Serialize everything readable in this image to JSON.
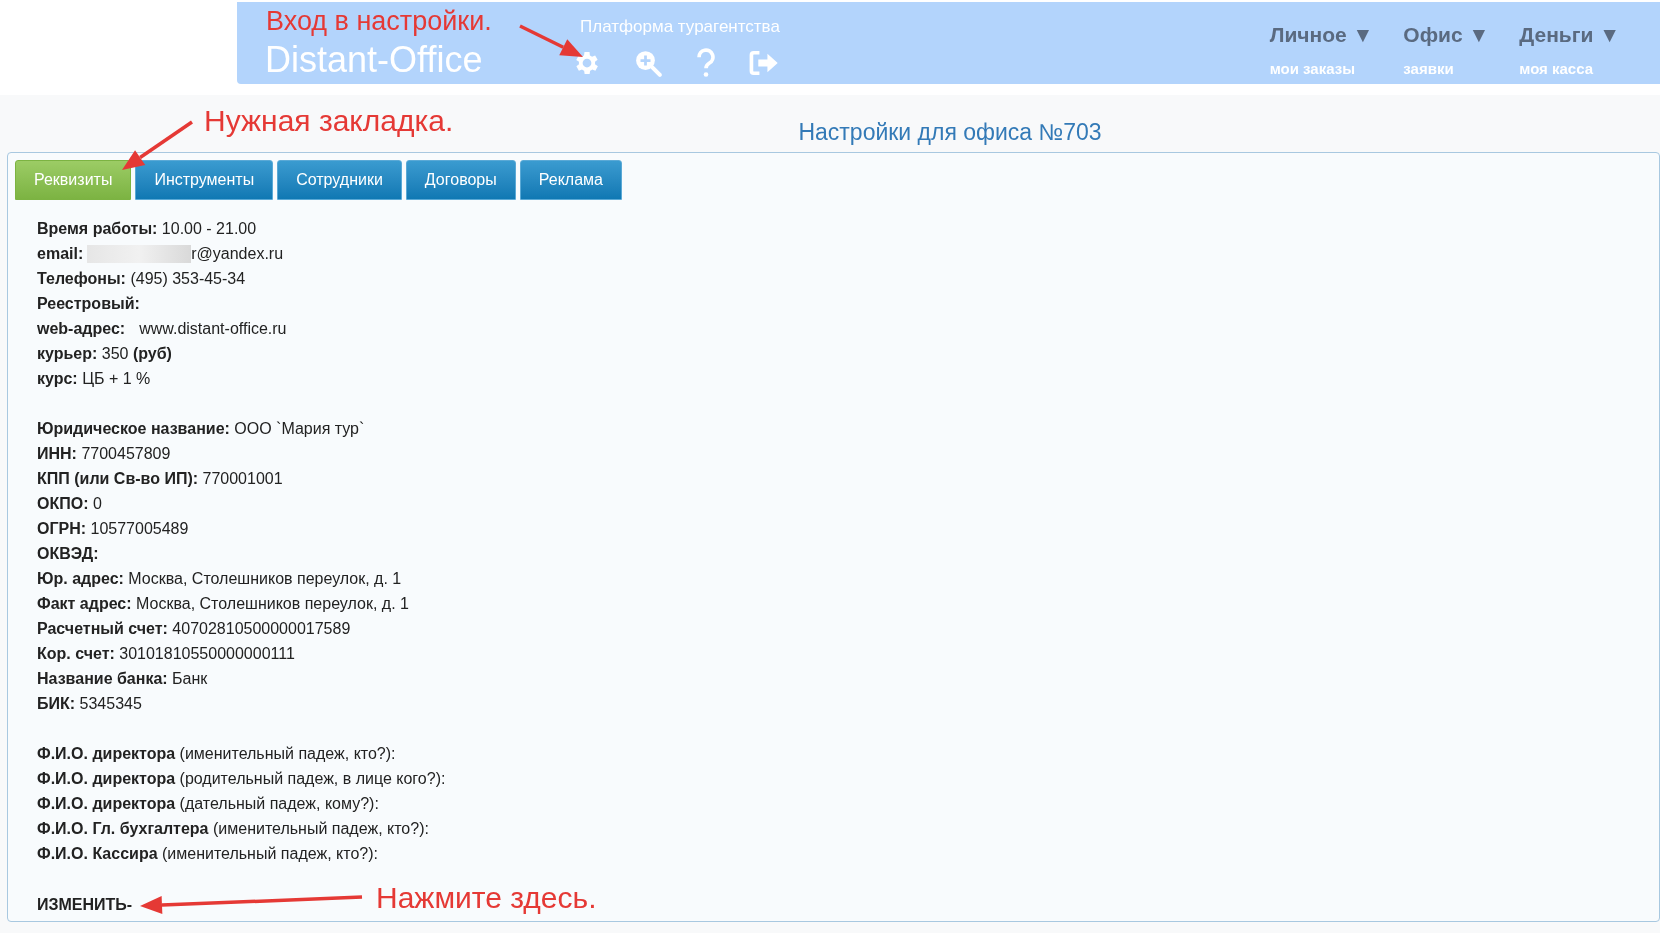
{
  "header": {
    "logo": "Distant-Office",
    "tagline": "Платформа турагентства",
    "menus": [
      {
        "label": "Личное ▼",
        "link": "мои заказы"
      },
      {
        "label": "Офис ▼",
        "link": "заявки"
      },
      {
        "label": "Деньги ▼",
        "link": "моя касса"
      }
    ]
  },
  "page_title": "Настройки для офиса №703",
  "tabs": [
    {
      "label": "Реквизиты",
      "selected": true
    },
    {
      "label": "Инструменты",
      "selected": false
    },
    {
      "label": "Сотрудники",
      "selected": false
    },
    {
      "label": "Договоры",
      "selected": false
    },
    {
      "label": "Реклама",
      "selected": false
    }
  ],
  "groups": [
    [
      {
        "kind": "plain",
        "label": "Время работы:",
        "value": "10.00 - 21.00"
      },
      {
        "kind": "redacted",
        "label": "email:",
        "value": "r@yandex.ru"
      },
      {
        "kind": "plain",
        "label": "Телефоны:",
        "value": "(495) 353-45-34"
      },
      {
        "kind": "plain",
        "label": "Реестровый:"
      },
      {
        "kind": "link",
        "label": "web-адрес:",
        "value": "www.distant-office.ru"
      },
      {
        "kind": "plain",
        "label": "курьер:",
        "value": "350 **(руб)**"
      },
      {
        "kind": "plain",
        "label": "курс:",
        "value": "ЦБ + 1 %"
      }
    ],
    [
      {
        "kind": "plain",
        "label": "Юридическое название:",
        "value": "ООО `Мария тур`"
      },
      {
        "kind": "plain",
        "label": "ИНН:",
        "value": "7700457809"
      },
      {
        "kind": "plain",
        "label": "КПП (или Св-во ИП):",
        "value": "770001001"
      },
      {
        "kind": "plain",
        "label": "ОКПО:",
        "value": "0"
      },
      {
        "kind": "plain",
        "label": "ОГРН:",
        "value": "10577005489"
      },
      {
        "kind": "plain",
        "label": "ОКВЭД:"
      },
      {
        "kind": "plain",
        "label": "Юр. адрес:",
        "value": "Москва, Столешников переулок, д. 1"
      },
      {
        "kind": "plain",
        "label": "Факт адрес:",
        "value": "Москва, Столешников переулок, д. 1"
      },
      {
        "kind": "plain",
        "label": "Расчетный счет:",
        "value": "40702810500000017589"
      },
      {
        "kind": "plain",
        "label": "Кор. счет:",
        "value": "30101810550000000111"
      },
      {
        "kind": "plain",
        "label": "Название банка:",
        "value": "Банк"
      },
      {
        "kind": "plain",
        "label": "БИК:",
        "value": "5345345"
      }
    ],
    [
      {
        "kind": "plain",
        "label": "Ф.И.О. директора",
        "value": "(именительный падеж, кто?):"
      },
      {
        "kind": "plain",
        "label": "Ф.И.О. директора",
        "value": "(родительный падеж, в лице кого?):"
      },
      {
        "kind": "plain",
        "label": "Ф.И.О. директора",
        "value": "(дательный падеж, кому?):"
      },
      {
        "kind": "plain",
        "label": "Ф.И.О. Гл. бухгалтера",
        "value": "(именительный падеж, кто?):"
      },
      {
        "kind": "plain",
        "label": "Ф.И.О. Кассира",
        "value": "(именительный падеж, кто?):"
      }
    ]
  ],
  "edit_link": "ИЗМЕНИТЬ-",
  "annotations": [
    "Вход в настройки.",
    "Нужная закладка.",
    "Нажмите здесь."
  ]
}
